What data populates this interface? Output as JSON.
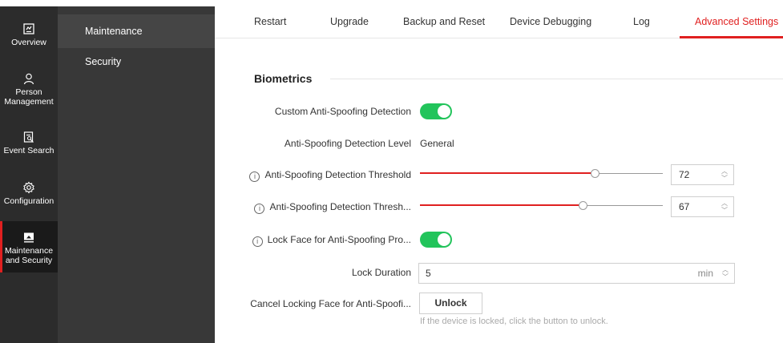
{
  "nav": {
    "items": [
      {
        "label": "Overview",
        "icon": "overview-icon"
      },
      {
        "label": "Person Management",
        "icon": "person-icon"
      },
      {
        "label": "Event Search",
        "icon": "event-search-icon"
      },
      {
        "label": "Configuration",
        "icon": "gear-icon"
      },
      {
        "label": "Maintenance and Security",
        "icon": "maintenance-icon",
        "active": true
      }
    ]
  },
  "submenu": {
    "items": [
      {
        "label": "Maintenance",
        "active": true
      },
      {
        "label": "Security"
      }
    ]
  },
  "tabs": [
    {
      "label": "Restart"
    },
    {
      "label": "Upgrade"
    },
    {
      "label": "Backup and Reset"
    },
    {
      "label": "Device Debugging"
    },
    {
      "label": "Log"
    },
    {
      "label": "Advanced Settings",
      "active": true
    }
  ],
  "section": {
    "title": "Biometrics"
  },
  "settings": {
    "custom_anti_spoofing": {
      "label": "Custom Anti-Spoofing Detection",
      "enabled": true
    },
    "detection_level": {
      "label": "Anti-Spoofing Detection Level",
      "value": "General"
    },
    "threshold1": {
      "label": "Anti-Spoofing Detection Threshold",
      "value": "72",
      "level": 72
    },
    "threshold2": {
      "label": "Anti-Spoofing Detection Thresh...",
      "value": "67",
      "level": 67
    },
    "lock_face": {
      "label": "Lock Face for Anti-Spoofing Pro...",
      "enabled": true
    },
    "lock_duration": {
      "label": "Lock Duration",
      "value": "5",
      "unit": "min"
    },
    "cancel_locking": {
      "label": "Cancel Locking Face for Anti-Spoofi...",
      "button": "Unlock",
      "hint": "If the device is locked, click the button to unlock."
    }
  },
  "colors": {
    "accent": "#e02020",
    "toggle_on": "#22c45b",
    "rail_bg": "#2c2c2c",
    "submenu_bg": "#383838"
  }
}
